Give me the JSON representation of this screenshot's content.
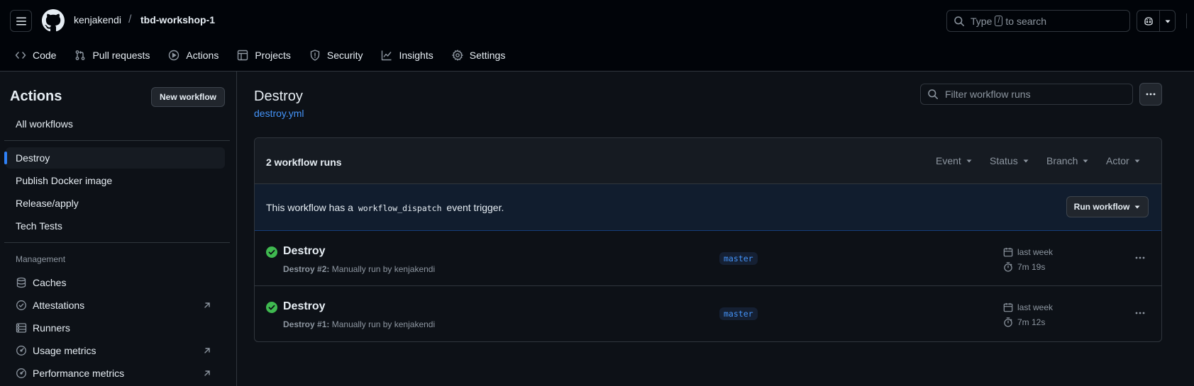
{
  "header": {
    "owner": "kenjakendi",
    "separator": "/",
    "repo": "tbd-workshop-1",
    "search_prefix": "Type",
    "search_key": "/",
    "search_suffix": "to search"
  },
  "nav": [
    {
      "label": "Code",
      "icon": "code-icon"
    },
    {
      "label": "Pull requests",
      "icon": "git-pull-request-icon"
    },
    {
      "label": "Actions",
      "icon": "play-icon"
    },
    {
      "label": "Projects",
      "icon": "table-icon"
    },
    {
      "label": "Security",
      "icon": "shield-icon"
    },
    {
      "label": "Insights",
      "icon": "graph-icon"
    },
    {
      "label": "Settings",
      "icon": "gear-icon"
    }
  ],
  "sidebar": {
    "title": "Actions",
    "new_workflow": "New workflow",
    "all_workflows": "All workflows",
    "workflows": [
      "Destroy",
      "Publish Docker image",
      "Release/apply",
      "Tech Tests"
    ],
    "management_label": "Management",
    "management": [
      {
        "label": "Caches",
        "icon": "database-icon",
        "external": false
      },
      {
        "label": "Attestations",
        "icon": "verified-icon",
        "external": true
      },
      {
        "label": "Runners",
        "icon": "server-icon",
        "external": false
      },
      {
        "label": "Usage metrics",
        "icon": "meter-icon",
        "external": true
      },
      {
        "label": "Performance metrics",
        "icon": "meter-icon",
        "external": true
      }
    ]
  },
  "main": {
    "title": "Destroy",
    "file_link": "destroy.yml",
    "filter_placeholder": "Filter workflow runs",
    "runs_count": "2 workflow runs",
    "filters": [
      "Event",
      "Status",
      "Branch",
      "Actor"
    ],
    "dispatch_prefix": "This workflow has a",
    "dispatch_code": "workflow_dispatch",
    "dispatch_suffix": "event trigger.",
    "run_workflow": "Run workflow",
    "runs": [
      {
        "title": "Destroy",
        "run_name": "Destroy #2:",
        "detail": "Manually run by kenjakendi",
        "branch": "master",
        "when": "last week",
        "duration": "7m 19s"
      },
      {
        "title": "Destroy",
        "run_name": "Destroy #1:",
        "detail": "Manually run by kenjakendi",
        "branch": "master",
        "when": "last week",
        "duration": "7m 12s"
      }
    ]
  },
  "colors": {
    "background": "#0d1117",
    "header_bg": "#010409",
    "accent_blue": "#4493f8",
    "success_green": "#3fb950",
    "border": "#30363d"
  }
}
